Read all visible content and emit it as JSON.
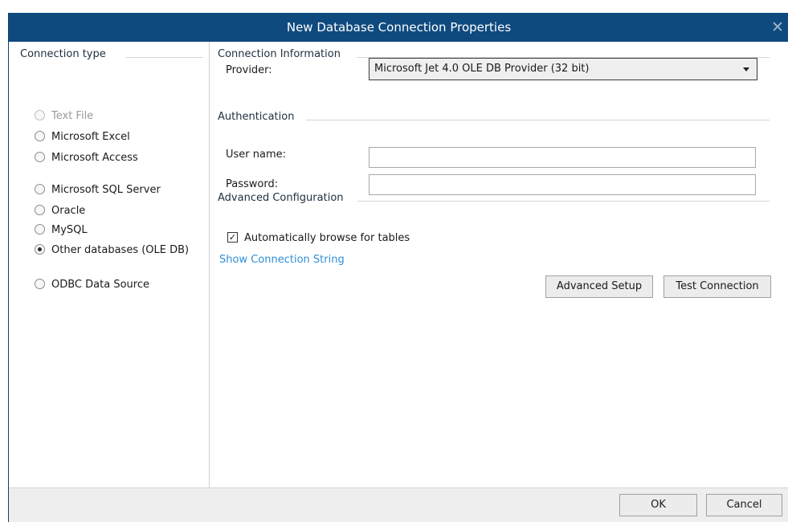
{
  "window": {
    "title": "New Database Connection Properties"
  },
  "connection_type": {
    "heading": "Connection type",
    "options": [
      {
        "label": "Text File",
        "state": "disabled"
      },
      {
        "label": "Microsoft Excel",
        "state": "unselected"
      },
      {
        "label": "Microsoft Access",
        "state": "unselected"
      },
      {
        "label": "Microsoft SQL Server",
        "state": "unselected"
      },
      {
        "label": "Oracle",
        "state": "unselected"
      },
      {
        "label": "MySQL",
        "state": "unselected"
      },
      {
        "label": "Other databases (OLE DB)",
        "state": "selected"
      },
      {
        "label": "ODBC Data Source",
        "state": "unselected"
      }
    ]
  },
  "connection_info": {
    "heading": "Connection Information",
    "provider_label": "Provider:",
    "provider_value": "Microsoft Jet 4.0 OLE DB Provider (32 bit)"
  },
  "authentication": {
    "heading": "Authentication",
    "username_label": "User name:",
    "username_value": "",
    "password_label": "Password:",
    "password_value": ""
  },
  "advanced": {
    "heading": "Advanced Configuration",
    "auto_browse_label": "Automatically browse for tables",
    "auto_browse_checked": true,
    "show_connection_string": "Show Connection String",
    "advanced_setup_label": "Advanced Setup",
    "test_connection_label": "Test Connection"
  },
  "footer": {
    "ok_label": "OK",
    "cancel_label": "Cancel"
  },
  "icons": {
    "close": "close-icon",
    "dropdown": "chevron-down-icon",
    "check": "checkmark-icon"
  },
  "colors": {
    "titlebar": "#0f4a7f",
    "link": "#2e8fd8",
    "footer": "#eeeeee"
  }
}
